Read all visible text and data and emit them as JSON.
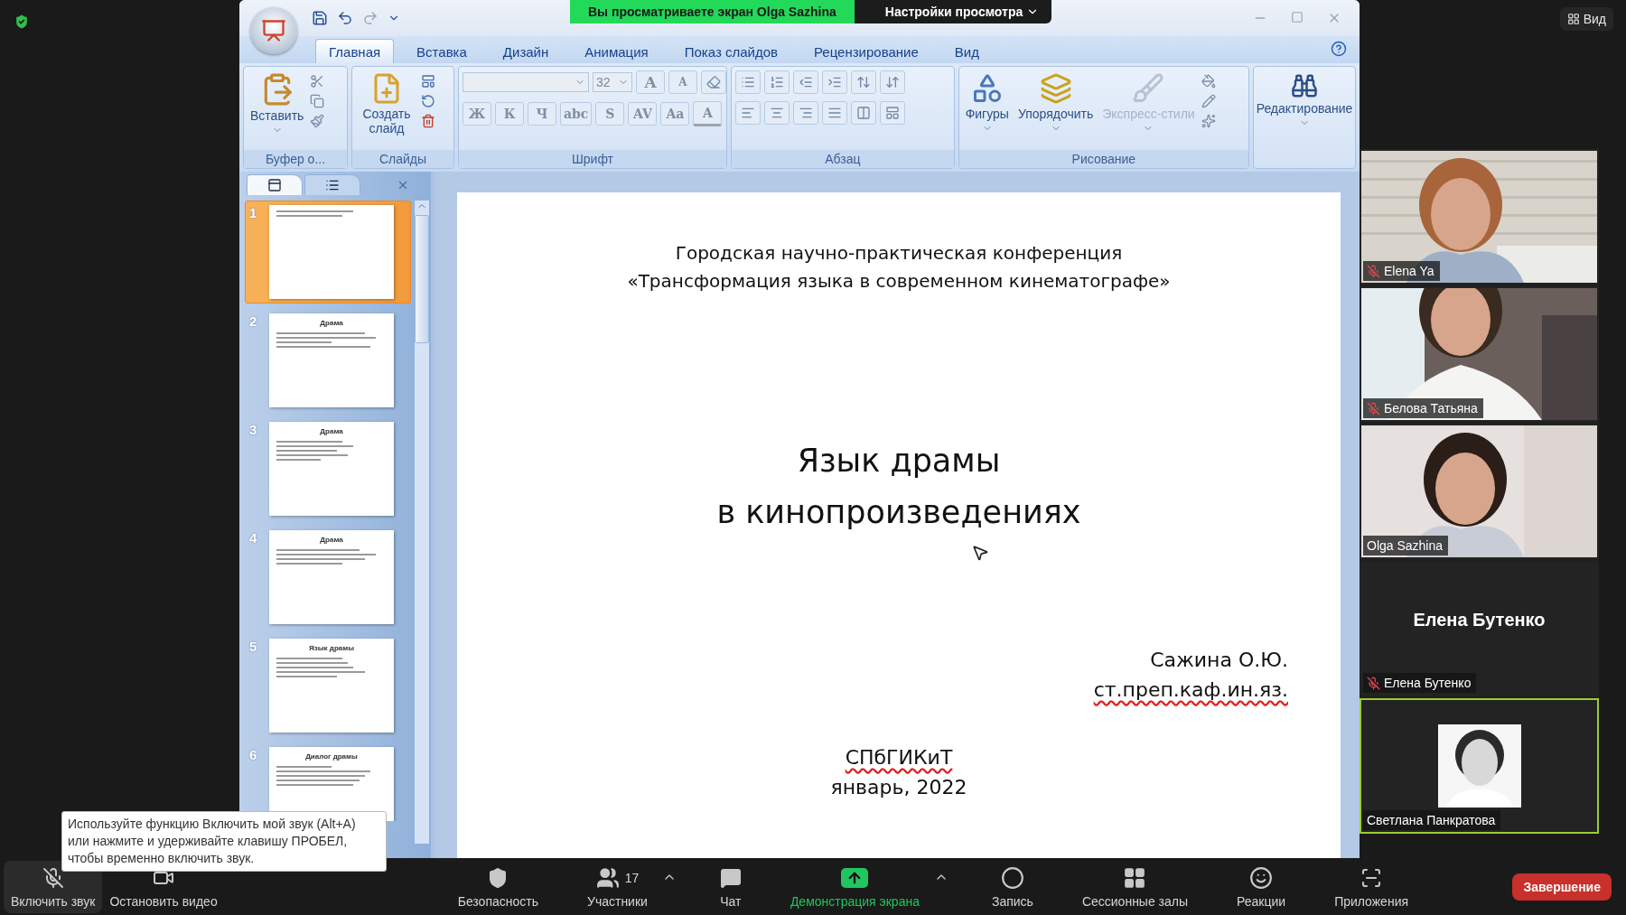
{
  "zoom_banner": {
    "text": "Вы просматриваете экран Olga Sazhina",
    "menu": "Настройки просмотра"
  },
  "view_button": "Вид",
  "ppt": {
    "tabs": [
      {
        "label": "Главная",
        "selected": true
      },
      {
        "label": "Вставка",
        "selected": false
      },
      {
        "label": "Дизайн",
        "selected": false
      },
      {
        "label": "Анимация",
        "selected": false
      },
      {
        "label": "Показ слайдов",
        "selected": false
      },
      {
        "label": "Рецензирование",
        "selected": false
      },
      {
        "label": "Вид",
        "selected": false
      }
    ],
    "ribbon": {
      "clipboard": {
        "label": "Буфер о...",
        "paste": "Вставить"
      },
      "slides": {
        "label": "Слайды",
        "new_slide": "Создать слайд"
      },
      "font": {
        "label": "Шрифт",
        "size": "32",
        "size_buttons": [
          "A",
          "A"
        ],
        "format_buttons": [
          "Ж",
          "К",
          "Ч",
          "abc",
          "S",
          "AV",
          "Aa"
        ],
        "color_button": "A"
      },
      "paragraph": {
        "label": "Абзац"
      },
      "drawing": {
        "label": "Рисование",
        "buttons": [
          {
            "kind": "shapes",
            "label": "Фигуры",
            "disabled": false
          },
          {
            "kind": "arrange",
            "label": "Упорядочить",
            "disabled": false
          },
          {
            "kind": "styles",
            "label": "Экспресс-стили",
            "disabled": true
          }
        ]
      },
      "editing": {
        "label": "Редактирование"
      }
    },
    "slide_pane": {
      "thumbnails": [
        {
          "number": "1",
          "selected": true
        },
        {
          "number": "2",
          "selected": false,
          "title": "Драма"
        },
        {
          "number": "3",
          "selected": false,
          "title": "Драма"
        },
        {
          "number": "4",
          "selected": false,
          "title": "Драма"
        },
        {
          "number": "5",
          "selected": false,
          "title": "Язык драмы"
        },
        {
          "number": "6",
          "selected": false,
          "title": "Диалог драмы"
        }
      ]
    },
    "slide": {
      "header": [
        "Городская научно-практическая конференция",
        "«Трансформация языка в современном кинематографе»"
      ],
      "title": [
        "Язык драмы",
        "в кинопроизведениях"
      ],
      "author": [
        {
          "text": "Сажина О.Ю.",
          "misspelled": false
        },
        {
          "text": "ст.преп.каф.ин.яз.",
          "misspelled": true
        }
      ],
      "footer": [
        {
          "text": "СПбГИКиТ",
          "misspelled": true
        },
        {
          "text": "январь, 2022",
          "misspelled": false
        }
      ]
    }
  },
  "participants": [
    {
      "name": "Elena Ya",
      "kind": "video",
      "muted": true,
      "speaking": false
    },
    {
      "name": "Белова Татьяна",
      "kind": "video",
      "muted": true,
      "speaking": false
    },
    {
      "name": "Olga Sazhina",
      "kind": "video",
      "muted": false,
      "speaking": false
    },
    {
      "name": "Елена Бутенко",
      "display_name": "Елена Бутенко",
      "kind": "name_only",
      "muted": true,
      "speaking": false
    },
    {
      "name": "Светлана Панкратова",
      "muted": false,
      "speaking": true
    }
  ],
  "tooltip": "Используйте функцию Включить мой звук (Alt+A) или нажмите и удерживайте клавишу ПРОБЕЛ, чтобы временно включить звук.",
  "toolbar": {
    "items": [
      {
        "kind": "audio",
        "label": "Включить звук",
        "highlighted": true,
        "active": false
      },
      {
        "kind": "video",
        "label": "Остановить видео",
        "highlighted": false,
        "active": false
      },
      {
        "kind": "security",
        "label": "Безопасность",
        "highlighted": false,
        "active": false
      },
      {
        "kind": "participants",
        "label": "Участники",
        "count": "17",
        "highlighted": false,
        "active": false,
        "menu": true
      },
      {
        "kind": "chat",
        "label": "Чат",
        "highlighted": false,
        "active": false
      },
      {
        "kind": "share",
        "label": "Демонстрация экрана",
        "highlighted": false,
        "active": true,
        "menu": true
      },
      {
        "kind": "record",
        "label": "Запись",
        "highlighted": false,
        "active": false
      },
      {
        "kind": "rooms",
        "label": "Сессионные залы",
        "highlighted": false,
        "active": false
      },
      {
        "kind": "reactions",
        "label": "Реакции",
        "highlighted": false,
        "active": false
      },
      {
        "kind": "apps",
        "label": "Приложения",
        "highlighted": false,
        "active": false
      }
    ],
    "end_button": "Завершение"
  }
}
